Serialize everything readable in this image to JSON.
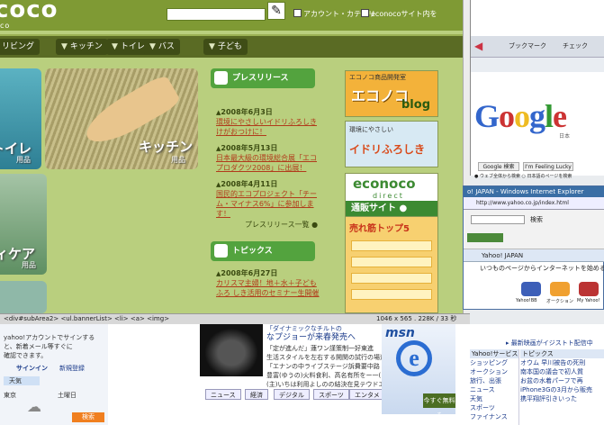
{
  "econoco": {
    "logo": "coco",
    "logo_sub": "co",
    "checkbox1": "アカウント・カテゴリ",
    "checkbox2": "econocoサイト内を",
    "nav": [
      "リビング",
      "キッチン",
      "トイレ",
      "バス",
      "子ども"
    ],
    "tiles": {
      "kitchen": "キッチン",
      "kitchen_sub": "用品",
      "toilet": "トイレ",
      "toilet_sub": "用品",
      "bath": "ィケア",
      "bath_sub": "用品"
    },
    "press": {
      "header": "プレスリリース",
      "items": [
        {
          "date": "2008年6月3日",
          "text": "環境にやさしいイドリふろしき けがおつけに！"
        },
        {
          "date": "2008年5月13日",
          "text": "日本最大級の環境総合展「エコ プロダクツ2008」に出展！"
        },
        {
          "date": "2008年4月11日",
          "text": "国民的エコプロジェクト「チーム・マイナス6%」に参加します！"
        }
      ],
      "more": "プレスリリース一覧"
    },
    "topics": {
      "header": "トピックス",
      "items": [
        {
          "date": "2008年6月27日",
          "text": "カリスマ主婦！地＋水＋子どもふろ しき活用のセミナー生開催"
        }
      ]
    },
    "banners": {
      "b1_title": "エコノコ商品開発室",
      "b1_logo": "エコノコ",
      "b1_sub": "blog",
      "b2_title": "環境にやさしい",
      "b2_logo": "イドリふろしき",
      "b3_logo": "econoco",
      "b3_sub": "direct",
      "b4_title": "通販サイト",
      "b4_sub": "売れ筋トップ5"
    },
    "status_path": "<div#subArea2> <ul.bannerList> <li> <a> <img>",
    "dims": "1046 x 565 . 228K / 33 秒"
  },
  "firefox": {
    "bookmarks": "ブックマーク",
    "check": "チェック",
    "google": "Google",
    "japan": "日本",
    "search_btn": "Google 検索",
    "lucky_btn": "I'm Feeling Lucky",
    "radio1": "ウェブ全体から検索",
    "radio2": "日本語のページを検索"
  },
  "ie": {
    "title": "o! JAPAN - Windows Internet Explorer",
    "address": "http://www.yahoo.co.jp/index.html",
    "search": "検索",
    "tab": "Yahoo! JAPAN",
    "tagline": "いつものページからインターネットを始める",
    "icons": [
      "Yahoo!BB",
      "オークション",
      "My Yahoo!"
    ]
  },
  "yahoo_bottom": {
    "login1": "yahoo!アカウントでサインする",
    "login2": "と、新着メール等すぐに",
    "login3": "確認できます。",
    "signin": "サインイン",
    "register": "新規登録",
    "weather": "天気",
    "city": "東京",
    "today": "土曜日",
    "car1": "「ダイナミックなチルトの",
    "car2": "なプジョーが来春発売へ",
    "news_lines": [
      "「定が進んだ」蓮ワン謹策制一好東進",
      "生活スタイルを左右する開関の試行の場道",
      "「エナンの中ライブステージ訴費要中路",
      "豊富(ゆうの)火料食利、高名有所をー一(ビ)",
      "(主)いちは利用よしのの結決在見テウドエ"
    ],
    "tabs": [
      "ニュース",
      "経済",
      "デジタル",
      "スポーツ",
      "エンタメ"
    ],
    "msn": "msn",
    "msn_btn": "今すぐ無料る",
    "services_title": "Yahoo!サービス",
    "services": [
      "ショッピング",
      "オークション",
      "旅行、出張",
      "ニュース",
      "天気",
      "スポーツ",
      "ファイナンス"
    ],
    "topics_title": "トピックス",
    "topics": [
      "オウム 早川被告の死刑",
      "南本国の議会で初人質",
      "お盆の水着パーフで再",
      "iPhone3Gの3月から販売",
      "携平翔評引きいった"
    ],
    "extra": "最新映画がイジストト配信中"
  },
  "colors": {
    "econ_green": "#b9cf7e",
    "econ_dark": "#7f9a34",
    "press_btn": "#53a33e",
    "news_red": "#b13b1b"
  }
}
